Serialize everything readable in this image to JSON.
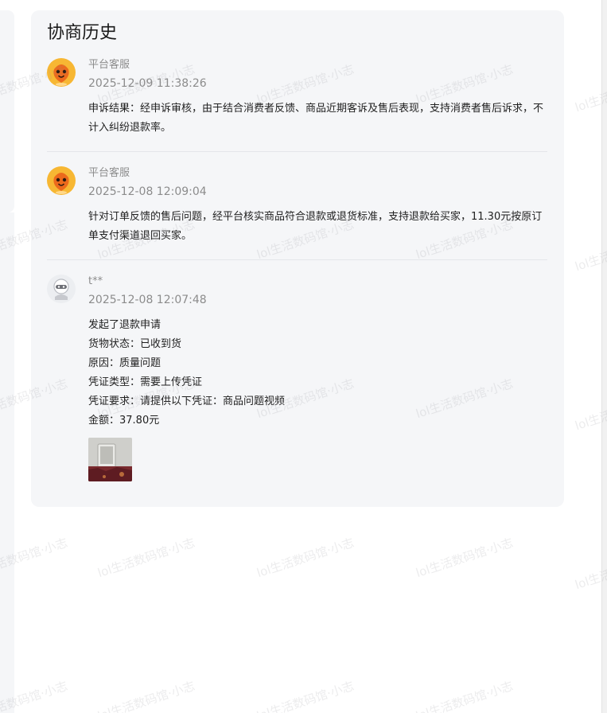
{
  "card": {
    "title": "协商历史"
  },
  "entries": [
    {
      "author": "平台客服",
      "time": "2025-12-09 11:38:26",
      "avatar_icon": "orange-mascot-avatar",
      "body": "申诉结果：经申诉审核，由于结合消费者反馈、商品近期客诉及售后表现，支持消费者售后诉求，不计入纠纷退款率。"
    },
    {
      "author": "平台客服",
      "time": "2025-12-08 12:09:04",
      "avatar_icon": "orange-mascot-avatar",
      "body": "针对订单反馈的售后问题，经平台核实商品符合退款或退货标准，支持退款给买家，11.30元按原订单支付渠道退回买家。"
    },
    {
      "author": "t**",
      "time": "2025-12-08 12:07:48",
      "avatar_icon": "grey-default-avatar",
      "lines": [
        "发起了退款申请",
        "货物状态：已收到货",
        "原因：质量问题",
        "凭证类型：需要上传凭证",
        "凭证要求：请提供以下凭证：商品问题视频",
        "金额：37.80元"
      ],
      "attachment_icon": "attachment-thumbnail"
    }
  ],
  "watermark": {
    "text": "lol生活数码馆·小志"
  }
}
